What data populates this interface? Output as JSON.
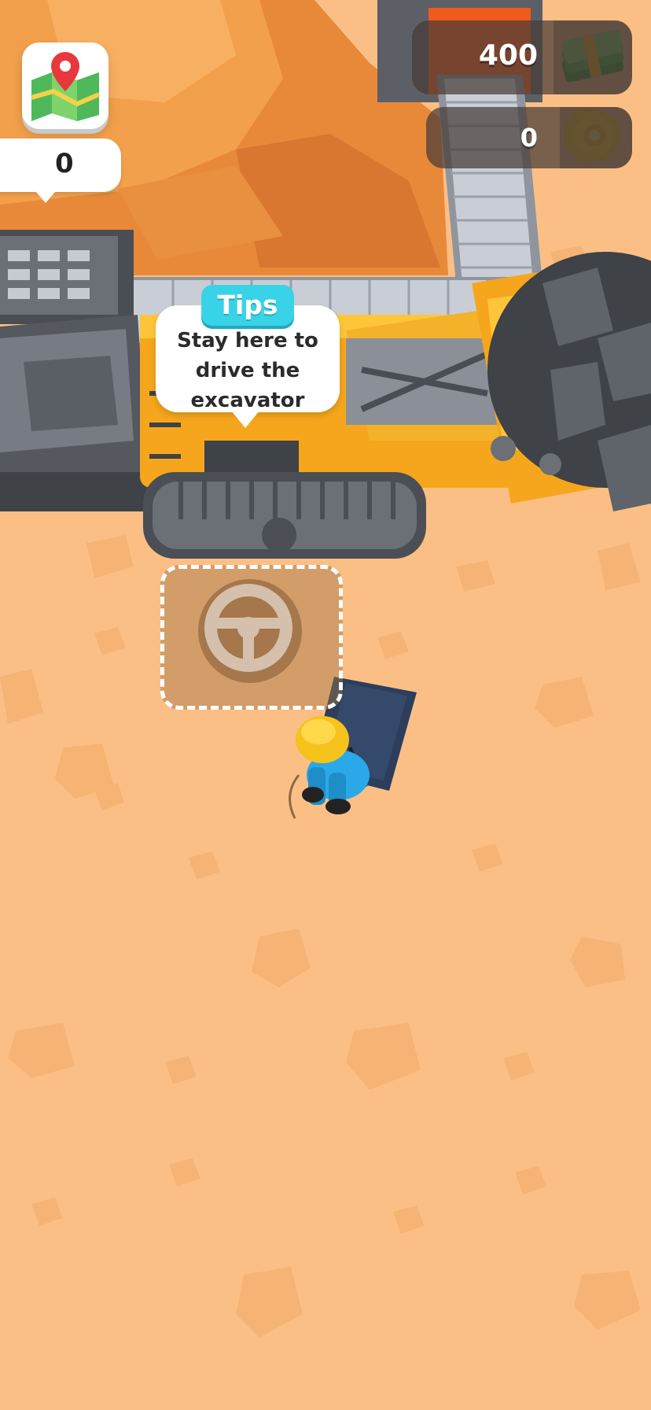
{
  "hud": {
    "cash": "400",
    "gears": "0"
  },
  "ore_counter": {
    "value": "0"
  },
  "tips": {
    "tag": "Tips",
    "message": "Stay here to drive the excavator"
  },
  "icons": {
    "map": "map-icon",
    "cash": "cash-stack-icon",
    "gear": "gear-coin-icon",
    "ore": "ore-rock-icon",
    "steering": "steering-wheel-icon"
  },
  "colors": {
    "ground": "#fbbf86",
    "mountain": "#e8893a",
    "excavator": "#f6a61c",
    "tips_tag": "#39d3e8",
    "worker_helmet": "#f6c21c",
    "worker_suit": "#2aa8e8"
  }
}
